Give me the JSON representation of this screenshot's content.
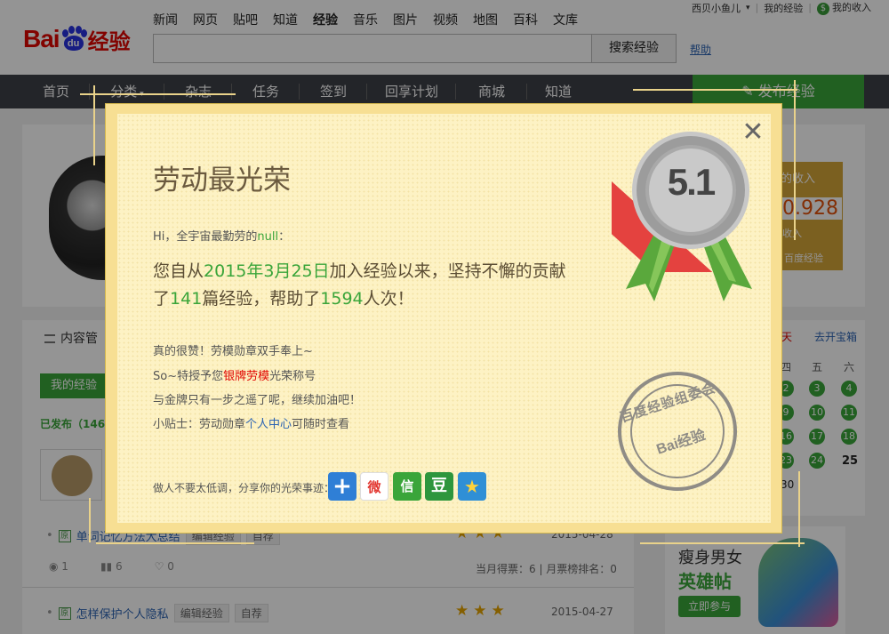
{
  "header": {
    "logo": {
      "bai": "Bai",
      "du": "du",
      "suffix": "经验"
    },
    "nav_links": [
      "新闻",
      "网页",
      "贴吧",
      "知道",
      "经验",
      "音乐",
      "图片",
      "视频",
      "地图",
      "百科",
      "文库"
    ],
    "active_nav": "经验",
    "search": {
      "value": "",
      "button": "搜索经验"
    },
    "help": "帮助",
    "user": {
      "name": "西贝小鱼儿",
      "links": [
        "我的经验",
        "我的收入"
      ]
    }
  },
  "navbar": {
    "items": [
      "首页",
      "分类",
      "杂志",
      "任务",
      "签到",
      "回享计划",
      "商城",
      "知道"
    ],
    "publish": "发布经验"
  },
  "profile": {
    "income": {
      "title": "的收入",
      "value": "0.928",
      "sub": "收入",
      "bottom": "百度经验"
    }
  },
  "content": {
    "title": "内容管",
    "tab": "我的经验",
    "published": "已发布（146）",
    "rows": [
      {
        "title": "单词记忆方法大总结",
        "edit": "编辑经验",
        "tag": "自荐",
        "date": "2015-04-28"
      },
      {
        "title": "怎样保护个人隐私",
        "edit": "编辑经验",
        "tag": "自荐",
        "date": "2015-04-27"
      }
    ],
    "stats": {
      "views": "1",
      "votes": "6",
      "likes": "0"
    },
    "ranking": "当月得票：6 | 月票榜排名：0"
  },
  "calendar": {
    "label_red": "天",
    "link": "去开宝箱",
    "weekdays": [
      "四",
      "五",
      "六"
    ],
    "days": [
      "2",
      "3",
      "4",
      "9",
      "10",
      "11",
      "16",
      "17",
      "18",
      "23",
      "24"
    ],
    "today": "25",
    "partial": "30"
  },
  "ad": {
    "line1": "瘦身男女",
    "line2": "英雄帖",
    "button": "立即参与"
  },
  "modal": {
    "title": "劳动最光荣",
    "badge": "5.1",
    "greeting_prefix": "Hi，全宇宙最勤劳的",
    "greeting_name": "null",
    "greeting_suffix": "：",
    "main": {
      "p1": "您自从",
      "join_date": "2015年3月25日",
      "p2": "加入经验以来，坚持不懈的贡献了",
      "count": "141",
      "p3": "篇经验，帮助了",
      "helped": "1594",
      "p4": "人次！"
    },
    "line1": "真的很赞！劳模勋章双手奉上~",
    "line2_prefix": "So~特授予您",
    "line2_highlight": "银牌劳模",
    "line2_suffix": "光荣称号",
    "line3": "与金牌只有一步之遥了呢，继续加油吧！",
    "line4_prefix": "小贴士：劳动勋章",
    "line4_link": "个人中心",
    "line4_suffix": "可随时查看",
    "share_label": "做人不要太低调，分享你的光荣事迹：",
    "share_icons": [
      {
        "name": "plus",
        "glyph": "+",
        "color": "#2f7fd6"
      },
      {
        "name": "weibo",
        "glyph": "微",
        "color": "#e2362f"
      },
      {
        "name": "wechat",
        "glyph": "信",
        "color": "#3aa53a"
      },
      {
        "name": "douban",
        "glyph": "豆",
        "color": "#2e963d"
      },
      {
        "name": "qzone",
        "glyph": "★",
        "color": "#2f8fd6"
      }
    ],
    "stamp": {
      "top": "百度经验组委会",
      "brand": "Bai经验"
    }
  }
}
